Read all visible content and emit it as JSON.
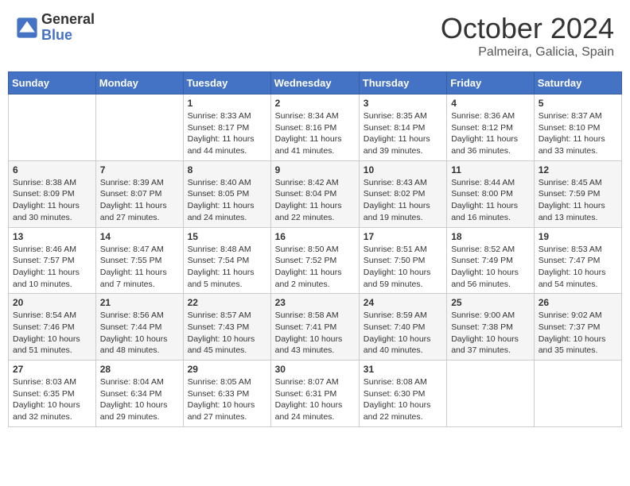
{
  "header": {
    "logo_line1": "General",
    "logo_line2": "Blue",
    "month": "October 2024",
    "location": "Palmeira, Galicia, Spain"
  },
  "days_of_week": [
    "Sunday",
    "Monday",
    "Tuesday",
    "Wednesday",
    "Thursday",
    "Friday",
    "Saturday"
  ],
  "weeks": [
    [
      {
        "day": "",
        "info": ""
      },
      {
        "day": "",
        "info": ""
      },
      {
        "day": "1",
        "info": "Sunrise: 8:33 AM\nSunset: 8:17 PM\nDaylight: 11 hours and 44 minutes."
      },
      {
        "day": "2",
        "info": "Sunrise: 8:34 AM\nSunset: 8:16 PM\nDaylight: 11 hours and 41 minutes."
      },
      {
        "day": "3",
        "info": "Sunrise: 8:35 AM\nSunset: 8:14 PM\nDaylight: 11 hours and 39 minutes."
      },
      {
        "day": "4",
        "info": "Sunrise: 8:36 AM\nSunset: 8:12 PM\nDaylight: 11 hours and 36 minutes."
      },
      {
        "day": "5",
        "info": "Sunrise: 8:37 AM\nSunset: 8:10 PM\nDaylight: 11 hours and 33 minutes."
      }
    ],
    [
      {
        "day": "6",
        "info": "Sunrise: 8:38 AM\nSunset: 8:09 PM\nDaylight: 11 hours and 30 minutes."
      },
      {
        "day": "7",
        "info": "Sunrise: 8:39 AM\nSunset: 8:07 PM\nDaylight: 11 hours and 27 minutes."
      },
      {
        "day": "8",
        "info": "Sunrise: 8:40 AM\nSunset: 8:05 PM\nDaylight: 11 hours and 24 minutes."
      },
      {
        "day": "9",
        "info": "Sunrise: 8:42 AM\nSunset: 8:04 PM\nDaylight: 11 hours and 22 minutes."
      },
      {
        "day": "10",
        "info": "Sunrise: 8:43 AM\nSunset: 8:02 PM\nDaylight: 11 hours and 19 minutes."
      },
      {
        "day": "11",
        "info": "Sunrise: 8:44 AM\nSunset: 8:00 PM\nDaylight: 11 hours and 16 minutes."
      },
      {
        "day": "12",
        "info": "Sunrise: 8:45 AM\nSunset: 7:59 PM\nDaylight: 11 hours and 13 minutes."
      }
    ],
    [
      {
        "day": "13",
        "info": "Sunrise: 8:46 AM\nSunset: 7:57 PM\nDaylight: 11 hours and 10 minutes."
      },
      {
        "day": "14",
        "info": "Sunrise: 8:47 AM\nSunset: 7:55 PM\nDaylight: 11 hours and 7 minutes."
      },
      {
        "day": "15",
        "info": "Sunrise: 8:48 AM\nSunset: 7:54 PM\nDaylight: 11 hours and 5 minutes."
      },
      {
        "day": "16",
        "info": "Sunrise: 8:50 AM\nSunset: 7:52 PM\nDaylight: 11 hours and 2 minutes."
      },
      {
        "day": "17",
        "info": "Sunrise: 8:51 AM\nSunset: 7:50 PM\nDaylight: 10 hours and 59 minutes."
      },
      {
        "day": "18",
        "info": "Sunrise: 8:52 AM\nSunset: 7:49 PM\nDaylight: 10 hours and 56 minutes."
      },
      {
        "day": "19",
        "info": "Sunrise: 8:53 AM\nSunset: 7:47 PM\nDaylight: 10 hours and 54 minutes."
      }
    ],
    [
      {
        "day": "20",
        "info": "Sunrise: 8:54 AM\nSunset: 7:46 PM\nDaylight: 10 hours and 51 minutes."
      },
      {
        "day": "21",
        "info": "Sunrise: 8:56 AM\nSunset: 7:44 PM\nDaylight: 10 hours and 48 minutes."
      },
      {
        "day": "22",
        "info": "Sunrise: 8:57 AM\nSunset: 7:43 PM\nDaylight: 10 hours and 45 minutes."
      },
      {
        "day": "23",
        "info": "Sunrise: 8:58 AM\nSunset: 7:41 PM\nDaylight: 10 hours and 43 minutes."
      },
      {
        "day": "24",
        "info": "Sunrise: 8:59 AM\nSunset: 7:40 PM\nDaylight: 10 hours and 40 minutes."
      },
      {
        "day": "25",
        "info": "Sunrise: 9:00 AM\nSunset: 7:38 PM\nDaylight: 10 hours and 37 minutes."
      },
      {
        "day": "26",
        "info": "Sunrise: 9:02 AM\nSunset: 7:37 PM\nDaylight: 10 hours and 35 minutes."
      }
    ],
    [
      {
        "day": "27",
        "info": "Sunrise: 8:03 AM\nSunset: 6:35 PM\nDaylight: 10 hours and 32 minutes."
      },
      {
        "day": "28",
        "info": "Sunrise: 8:04 AM\nSunset: 6:34 PM\nDaylight: 10 hours and 29 minutes."
      },
      {
        "day": "29",
        "info": "Sunrise: 8:05 AM\nSunset: 6:33 PM\nDaylight: 10 hours and 27 minutes."
      },
      {
        "day": "30",
        "info": "Sunrise: 8:07 AM\nSunset: 6:31 PM\nDaylight: 10 hours and 24 minutes."
      },
      {
        "day": "31",
        "info": "Sunrise: 8:08 AM\nSunset: 6:30 PM\nDaylight: 10 hours and 22 minutes."
      },
      {
        "day": "",
        "info": ""
      },
      {
        "day": "",
        "info": ""
      }
    ]
  ]
}
